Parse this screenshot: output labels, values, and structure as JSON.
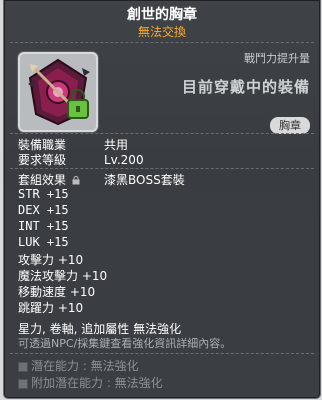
{
  "item": {
    "title": "創世的胸章",
    "subtitle": "無法交換",
    "power_label": "戰鬥力提升量",
    "equipped_text": "目前穿戴中的裝備",
    "slot_badge": "胸章",
    "icon": "badge-icon"
  },
  "requirements": [
    {
      "key": "裝備職業",
      "value": "共用"
    },
    {
      "key": "要求等級",
      "value": "Lv.200"
    }
  ],
  "set_effect": {
    "label": "套組效果",
    "icon": "lock-icon",
    "name": "漆黑BOSS套裝"
  },
  "stats": [
    {
      "name": "STR",
      "value": "+15"
    },
    {
      "name": "DEX",
      "value": "+15"
    },
    {
      "name": "INT",
      "value": "+15"
    },
    {
      "name": "LUK",
      "value": "+15"
    },
    {
      "name": "攻擊力",
      "value": "+10"
    },
    {
      "name": "魔法攻擊力",
      "value": "+10"
    },
    {
      "name": "移動速度",
      "value": "+10"
    },
    {
      "name": "跳躍力",
      "value": "+10"
    }
  ],
  "flags": "星力, 卷軸, 追加屬性 無法強化",
  "hint": "可透過NPC/採集鍵查看強化資訊詳細內容。",
  "potentials": [
    {
      "label": "潛在能力 : 無法強化"
    },
    {
      "label": "附加潛在能力 : 無法強化"
    }
  ],
  "colors": {
    "title": "#ffffff",
    "subtitle": "#ffaa22",
    "background": "#3b3f43"
  }
}
